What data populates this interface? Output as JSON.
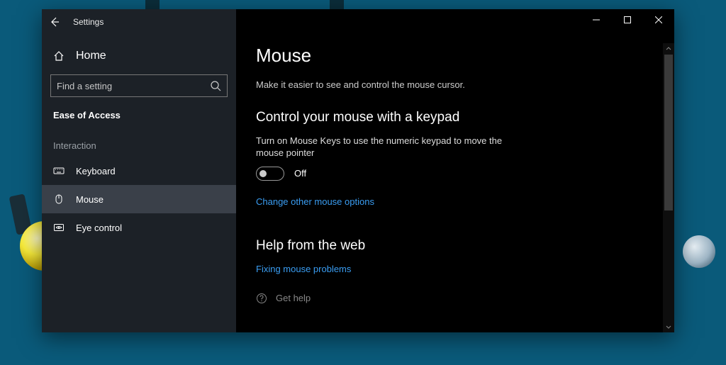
{
  "titlebar": {
    "app_name": "Settings"
  },
  "sidebar": {
    "home_label": "Home",
    "search_placeholder": "Find a setting",
    "section_label": "Ease of Access",
    "group_label": "Interaction",
    "items": [
      {
        "label": "Keyboard"
      },
      {
        "label": "Mouse"
      },
      {
        "label": "Eye control"
      }
    ]
  },
  "main": {
    "page_title": "Mouse",
    "subtitle": "Make it easier to see and control the mouse cursor.",
    "section1": {
      "heading": "Control your mouse with a keypad",
      "description": "Turn on Mouse Keys to use the numeric keypad to move the mouse pointer",
      "toggle_state": "Off",
      "link": "Change other mouse options"
    },
    "section2": {
      "heading": "Help from the web",
      "link": "Fixing mouse problems"
    },
    "help_link": "Get help"
  }
}
